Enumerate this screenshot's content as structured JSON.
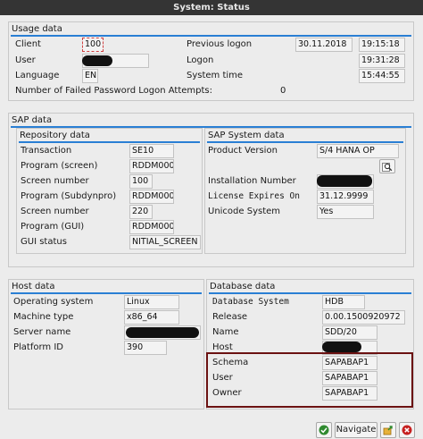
{
  "window": {
    "title": "System: Status"
  },
  "usage": {
    "title": "Usage data",
    "client_label": "Client",
    "client_value": "100",
    "user_label": "User",
    "language_label": "Language",
    "language_value": "EN",
    "prev_logon_label": "Previous logon",
    "prev_logon_date": "30.11.2018",
    "prev_logon_time": "19:15:18",
    "logon_label": "Logon",
    "logon_time": "19:31:28",
    "system_time_label": "System time",
    "system_time_value": "15:44:55",
    "failed_label": "Number of Failed Password Logon Attempts:",
    "failed_value": "0"
  },
  "sap": {
    "title": "SAP data",
    "repository": {
      "title": "Repository data",
      "rows": [
        {
          "label": "Transaction",
          "value": "SE10"
        },
        {
          "label": "Program (screen)",
          "value": "RDDM0001"
        },
        {
          "label": "Screen number",
          "value": "100"
        },
        {
          "label": "Program (Subdynpro)",
          "value": "RDDM0001"
        },
        {
          "label": "Screen number",
          "value": "220"
        },
        {
          "label": "Program (GUI)",
          "value": "RDDM0001"
        },
        {
          "label": "GUI status",
          "value": "NITIAL_SCREEN"
        }
      ]
    },
    "system": {
      "title": "SAP System data",
      "product_label": "Product Version",
      "product_value": "S/4 HANA OP",
      "install_label": "Installation Number",
      "license_label": "License Expires On",
      "license_value": "31.12.9999",
      "unicode_label": "Unicode System",
      "unicode_value": "Yes"
    }
  },
  "host": {
    "title": "Host data",
    "os_label": "Operating system",
    "os_value": "Linux",
    "machine_label": "Machine type",
    "machine_value": "x86_64",
    "server_label": "Server name",
    "platform_label": "Platform ID",
    "platform_value": "390"
  },
  "database": {
    "title": "Database data",
    "system_label": "Database System",
    "system_value": "HDB",
    "release_label": "Release",
    "release_value": "0.00.1500920972",
    "name_label": "Name",
    "name_value": "SDD/20",
    "host_label": "Host",
    "schema_label": "Schema",
    "schema_value": "SAPABAP1",
    "user_label": "User",
    "user_value": "SAPABAP1",
    "owner_label": "Owner",
    "owner_value": "SAPABAP1"
  },
  "footer": {
    "navigate_label": "Navigate"
  },
  "colors": {
    "group_accent": "#2a7fd4",
    "highlight": "#6b1212",
    "confirm_green": "#2f8a2f",
    "cancel_red": "#c62020"
  }
}
